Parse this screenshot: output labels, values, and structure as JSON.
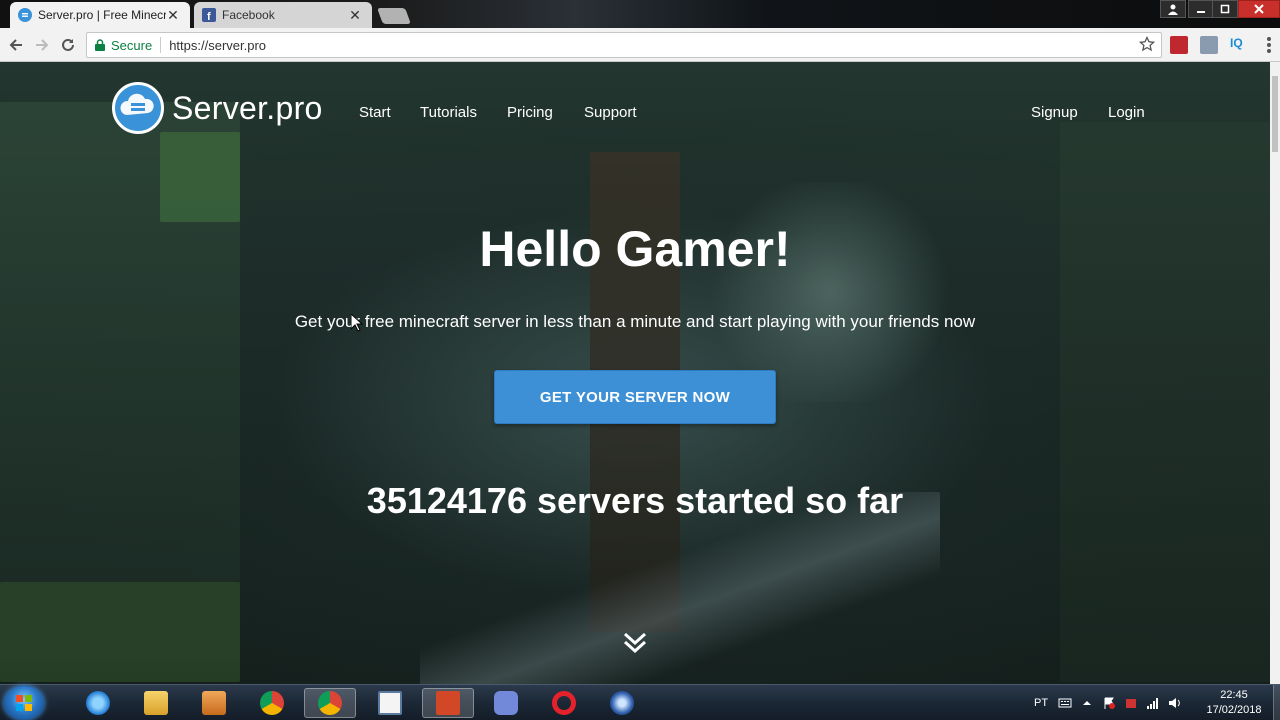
{
  "browser": {
    "tabs": [
      {
        "title": "Server.pro | Free Minecra",
        "active": true,
        "favicon": "serverpro-cloud-icon"
      },
      {
        "title": "Facebook",
        "active": false,
        "favicon": "facebook-icon"
      }
    ],
    "close_glyph": "✕",
    "address": {
      "secure_label": "Secure",
      "url": "https://server.pro"
    },
    "extensions": {
      "iq_label": "IQ"
    }
  },
  "site": {
    "logo_text": "Server.pro",
    "nav_left": [
      "Start",
      "Tutorials",
      "Pricing",
      "Support"
    ],
    "nav_right": [
      "Signup",
      "Login"
    ],
    "hero_title": "Hello Gamer!",
    "hero_subtitle": "Get your free minecraft server in less than a minute and start playing with your friends now",
    "cta_label": "GET YOUR SERVER NOW",
    "server_count_text": "35124176 servers started so far"
  },
  "taskbar": {
    "apps": [
      "internet-explorer",
      "file-explorer",
      "media-player",
      "chrome",
      "chrome",
      "notepad",
      "powerpoint",
      "discord",
      "opera",
      "app-blue"
    ],
    "active_app_index": 4,
    "language": "PT",
    "time": "22:45",
    "date": "17/02/2018"
  },
  "colors": {
    "accent": "#3d8fd6",
    "secure_green": "#0b8043"
  }
}
